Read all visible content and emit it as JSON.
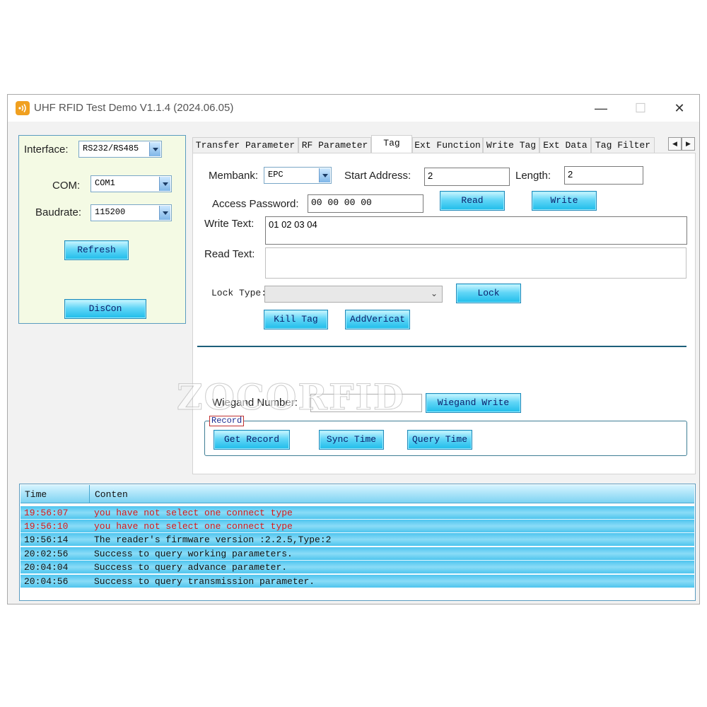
{
  "window": {
    "title": "UHF RFID Test Demo V1.1.4  (2024.06.05)",
    "minimize_glyph": "—",
    "maximize_glyph": "☐",
    "close_glyph": "✕"
  },
  "connection": {
    "interface_label": "Interface:",
    "interface_value": "RS232/RS485",
    "com_label": "COM:",
    "com_value": "COM1",
    "baudrate_label": "Baudrate:",
    "baudrate_value": "115200",
    "refresh_label": "Refresh",
    "discon_label": "DisCon"
  },
  "tabs": [
    {
      "label": "Transfer Parameter",
      "active": false
    },
    {
      "label": "RF Parameter",
      "active": false
    },
    {
      "label": "Tag",
      "active": true
    },
    {
      "label": "Ext Function",
      "active": false
    },
    {
      "label": "Write Tag",
      "active": false
    },
    {
      "label": "Ext Data",
      "active": false
    },
    {
      "label": "Tag Filter",
      "active": false
    }
  ],
  "tab_scroll": {
    "left": "◀",
    "right": "▶"
  },
  "tag": {
    "membank_label": "Membank:",
    "membank_value": "EPC",
    "start_address_label": "Start Address:",
    "start_address_value": "2",
    "length_label": "Length:",
    "length_value": "2",
    "access_password_label": "Access Password:",
    "access_password_value": "00 00 00 00",
    "read_label": "Read",
    "write_label": "Write",
    "write_text_label": "Write Text:",
    "write_text_value": "01 02 03 04",
    "read_text_label": "Read Text:",
    "read_text_value": "",
    "lock_type_label": "Lock Type:",
    "lock_type_value": "",
    "lock_label": "Lock",
    "kill_tag_label": "Kill Tag",
    "add_vericat_label": "AddVericat",
    "wiegand_number_label": "Wiegand Number:",
    "wiegand_number_value": "",
    "wiegand_write_label": "Wiegand Write",
    "record_title": "Record",
    "get_record_label": "Get Record",
    "sync_time_label": "Sync Time",
    "query_time_label": "Query Time"
  },
  "watermark": "ZOCORFID",
  "log": {
    "columns": [
      "Time",
      "Conten"
    ],
    "rows": [
      {
        "time": "19:56:07",
        "content": "you have not select one connect type",
        "status": "error"
      },
      {
        "time": "19:56:10",
        "content": "you have not select one connect type",
        "status": "error"
      },
      {
        "time": "19:56:14",
        "content": "The reader's firmware version :2.2.5,Type:2",
        "status": "ok"
      },
      {
        "time": "20:02:56",
        "content": "Success to query working parameters.",
        "status": "ok"
      },
      {
        "time": "20:04:04",
        "content": "Success to query advance parameter.",
        "status": "ok"
      },
      {
        "time": "20:04:56",
        "content": "Success to query transmission parameter.",
        "status": "ok"
      }
    ]
  },
  "colors": {
    "error_text": "#d81818",
    "button_gradient_mid": "#62d6f7",
    "left_panel_bg": "#f4fae4",
    "app_icon": "#f0a020"
  },
  "icons": {
    "app": "rfid-signal-icon",
    "dropdown": "chevron-down-icon"
  }
}
